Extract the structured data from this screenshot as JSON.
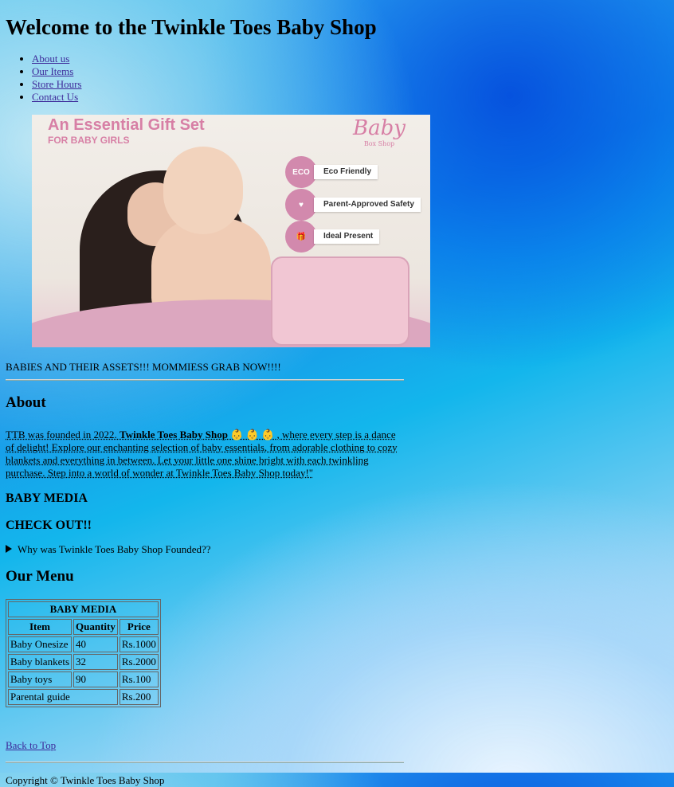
{
  "header": {
    "title": "Welcome to the Twinkle Toes Baby Shop"
  },
  "nav": {
    "items": [
      {
        "label": "About us"
      },
      {
        "label": "Our Items"
      },
      {
        "label": "Store Hours"
      },
      {
        "label": "Contact Us"
      }
    ]
  },
  "banner": {
    "title": "An Essential Gift Set",
    "subtitle": "FOR BABY GIRLS",
    "logo_main": "Baby",
    "logo_sub": "Box Shop",
    "features": [
      "Eco Friendly",
      "Parent-Approved Safety",
      "Ideal Present"
    ],
    "eco_badge": "ECO"
  },
  "tagline": "BABIES AND THEIR ASSETS!!! MOMMIESS GRAB NOW!!!!",
  "about": {
    "heading": "About",
    "text_before": "TTB was founded in 2022. ",
    "brand": "Twinkle Toes Baby Shop",
    "emoji": " 👶 👶 👶 ",
    "text_after": ", where every step is a dance of delight! Explore our enchanting selection of baby essentials, from adorable clothing to cozy blankets and everything in between. Let your little one shine bright with each twinkling purchase. Step into a world of wonder at Twinkle Toes Baby Shop today!\""
  },
  "media": {
    "heading1": "BABY MEDIA",
    "heading2": "CHECK OUT!!",
    "details_summary": "Why was Twinkle Toes Baby Shop Founded??"
  },
  "menu": {
    "heading": "Our Menu",
    "caption": "BABY MEDIA",
    "columns": [
      "Item",
      "Quantity",
      "Price"
    ],
    "rows": [
      [
        "Baby Onesize",
        "40",
        "Rs.1000"
      ],
      [
        "Baby blankets",
        "32",
        "Rs.2000"
      ],
      [
        "Baby toys",
        "90",
        "Rs.100"
      ]
    ],
    "last_row": {
      "item": "Parental guide",
      "price": "Rs.200"
    }
  },
  "footer": {
    "back_to_top": "Back to Top",
    "copyright": "Copyright © Twinkle Toes Baby Shop"
  },
  "colors": {
    "link": "#3d2a9a",
    "banner_pink": "#d77fa5"
  }
}
